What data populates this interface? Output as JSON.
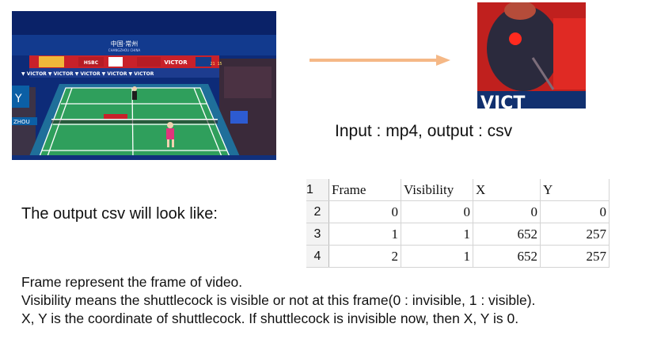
{
  "images": {
    "court_frame": {
      "description_icon": "badminton-broadcast-frame",
      "banner_title": "中国·常州",
      "banner_subtitle": "CHANGZHOU CHINA",
      "sponsor_brand": "VICTOR",
      "sponsor_bank": "HSBC",
      "score_hint": "21 15",
      "corner_city": "ZHOU"
    },
    "crop_frame": {
      "description_icon": "shuttlecock-crop",
      "banner_fragment": "VICT",
      "highlight_color": "#ff2a1f"
    }
  },
  "io_caption": "Input : mp4, output : csv",
  "csv_intro": "The output csv will look like:",
  "sheet": {
    "row_numbers": [
      "1",
      "2",
      "3",
      "4"
    ],
    "headers": [
      "Frame",
      "Visibility",
      "X",
      "Y"
    ],
    "rows": [
      [
        "0",
        "0",
        "0",
        "0"
      ],
      [
        "1",
        "1",
        "652",
        "257"
      ],
      [
        "2",
        "1",
        "652",
        "257"
      ]
    ]
  },
  "explanation": [
    "Frame represent the frame of video.",
    "Visibility means the shuttlecock is visible or not at this frame(0 : invisible, 1 : visible).",
    "X, Y is the coordinate of shuttlecock. If shuttlecock is invisible now, then X, Y is 0."
  ],
  "colors": {
    "arrow": "#f5b886",
    "court_green": "#2f9f5c",
    "court_outer": "#1f6f9a",
    "sheet_grid": "#d4d4d4"
  }
}
